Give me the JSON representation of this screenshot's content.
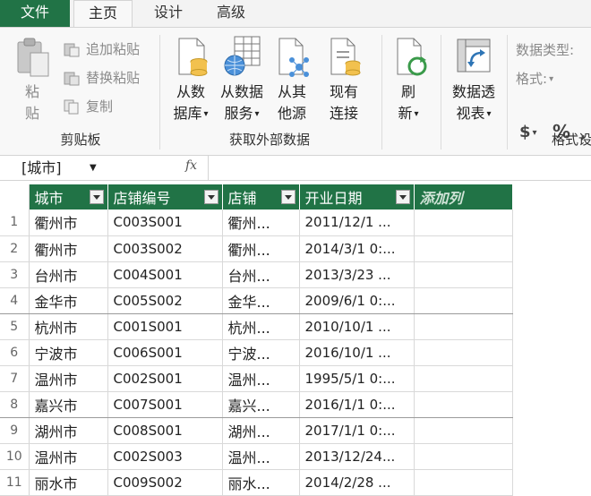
{
  "tabs": {
    "file": "文件",
    "home": "主页",
    "design": "设计",
    "advanced": "高级"
  },
  "ribbon": {
    "clipboard": {
      "paste_line1": "粘",
      "paste_line2": "贴",
      "append_paste": "追加粘贴",
      "replace_paste": "替换粘贴",
      "copy": "复制",
      "group_label": "剪贴板"
    },
    "external": {
      "from_db_1": "从数",
      "from_db_2": "据库",
      "from_svc_1": "从数据",
      "from_svc_2": "服务",
      "from_other_1": "从其",
      "from_other_2": "他源",
      "existing_1": "现有",
      "existing_2": "连接",
      "group_label": "获取外部数据"
    },
    "refresh_1": "刷",
    "refresh_2": "新",
    "pivot_1": "数据透",
    "pivot_2": "视表",
    "format": {
      "data_type": "数据类型:",
      "format": "格式:",
      "currency": "$",
      "percent": "%",
      "group_label": "格式设"
    }
  },
  "formula_bar": {
    "name_box": "[城市]",
    "fx": "fx"
  },
  "table": {
    "columns": [
      "城市",
      "店铺编号",
      "店铺",
      "开业日期"
    ],
    "add_column": "添加列",
    "rows": [
      [
        "1",
        "衢州市",
        "C003S001",
        "衢州...",
        "2011/12/1 ..."
      ],
      [
        "2",
        "衢州市",
        "C003S002",
        "衢州...",
        "2014/3/1 0:..."
      ],
      [
        "3",
        "台州市",
        "C004S001",
        "台州...",
        "2013/3/23 ..."
      ],
      [
        "4",
        "金华市",
        "C005S002",
        "金华...",
        "2009/6/1 0:..."
      ],
      [
        "5",
        "杭州市",
        "C001S001",
        "杭州...",
        "2010/10/1 ..."
      ],
      [
        "6",
        "宁波市",
        "C006S001",
        "宁波...",
        "2016/10/1 ..."
      ],
      [
        "7",
        "温州市",
        "C002S001",
        "温州...",
        "1995/5/1 0:..."
      ],
      [
        "8",
        "嘉兴市",
        "C007S001",
        "嘉兴...",
        "2016/1/1 0:..."
      ],
      [
        "9",
        "湖州市",
        "C008S001",
        "湖州...",
        "2017/1/1 0:..."
      ],
      [
        "10",
        "温州市",
        "C002S003",
        "温州...",
        "2013/12/24..."
      ],
      [
        "11",
        "丽水市",
        "C009S002",
        "丽水...",
        "2014/2/28 ..."
      ]
    ]
  },
  "colors": {
    "header_green": "#217346",
    "accent_blue": "#2e75b6"
  },
  "icons": [
    "paste-icon",
    "append-paste-icon",
    "replace-paste-icon",
    "copy-icon",
    "database-icon",
    "data-service-icon",
    "other-source-icon",
    "existing-connection-icon",
    "refresh-icon",
    "pivot-table-icon",
    "filter-dropdown-icon"
  ]
}
